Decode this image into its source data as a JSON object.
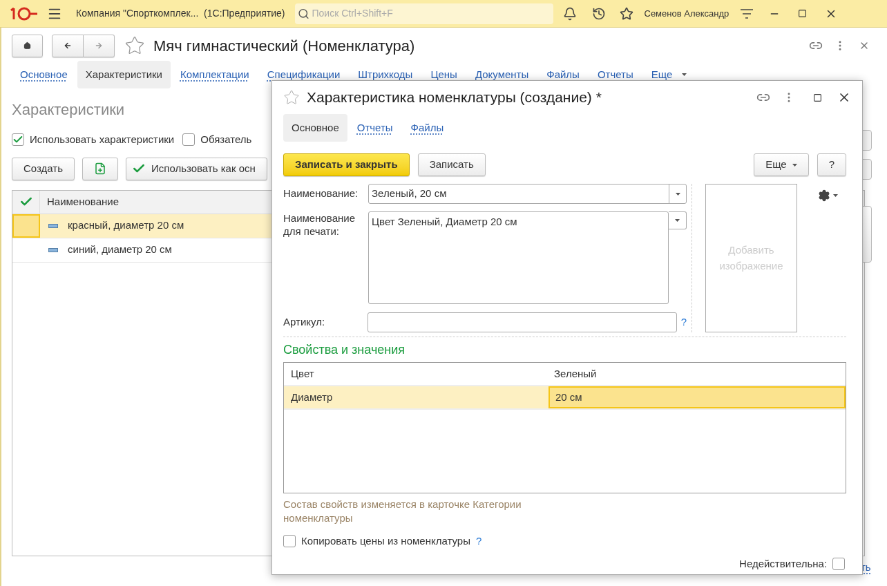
{
  "app_bar": {
    "title": "Компания \"Спорткомплек...  (1С:Предприятие)",
    "search_placeholder": "Поиск Ctrl+Shift+F",
    "user": "Семенов Александр"
  },
  "form": {
    "title": "Мяч гимнастический (Номенклатура)",
    "tabs": [
      {
        "label": "Основное",
        "selected": false
      },
      {
        "label": "Характеристики",
        "selected": true
      },
      {
        "label": "Комплектации",
        "selected": false
      },
      {
        "label": "Спецификации",
        "selected": false
      },
      {
        "label": "Штрихкоды",
        "selected": false
      },
      {
        "label": "Цены",
        "selected": false
      },
      {
        "label": "Документы",
        "selected": false
      },
      {
        "label": "Файлы",
        "selected": false
      },
      {
        "label": "Отчеты",
        "selected": false
      },
      {
        "label": "Еще",
        "selected": false
      }
    ],
    "section_title": "Характеристики",
    "checkboxes": [
      {
        "label": "Использовать характеристики",
        "checked": true
      },
      {
        "label": "Обязатель",
        "checked": false
      }
    ],
    "create_button": "Создать",
    "use_button": "Использовать как осн",
    "table": {
      "column": "Наименование",
      "rows": [
        {
          "name": "красный, диаметр 20 см",
          "selected": true
        },
        {
          "name": "синий, диаметр 20 см",
          "selected": false
        }
      ]
    },
    "footer_link": "ть"
  },
  "dialog": {
    "title": "Характеристика номенклатуры (создание) *",
    "tabs": [
      {
        "label": "Основное",
        "selected": true
      },
      {
        "label": "Отчеты",
        "selected": false
      },
      {
        "label": "Файлы",
        "selected": false
      }
    ],
    "save_close": "Записать и закрыть",
    "save": "Записать",
    "more": "Еще",
    "help": "?",
    "name": {
      "label": "Наименование:",
      "value": "Зеленый, 20 см"
    },
    "print_name": {
      "label": "Наименование для печати:",
      "value": "Цвет Зеленый, Диаметр 20 см"
    },
    "article": {
      "label": "Артикул:",
      "hint": "?"
    },
    "image_placeholder": "Добавить изображение",
    "properties": {
      "title": "Свойства и значения",
      "rows": [
        {
          "property": "Цвет",
          "value": "Зеленый",
          "selected": false
        },
        {
          "property": "Диаметр",
          "value": "20 см",
          "selected": true
        }
      ]
    },
    "note": "Состав свойств изменяется в карточке Категории номенклатуры",
    "copy_prices": {
      "label": "Копировать цены из номенклатуры",
      "hint": "?",
      "checked": false
    },
    "inactive": {
      "label": "Недействительна:",
      "checked": false
    }
  }
}
